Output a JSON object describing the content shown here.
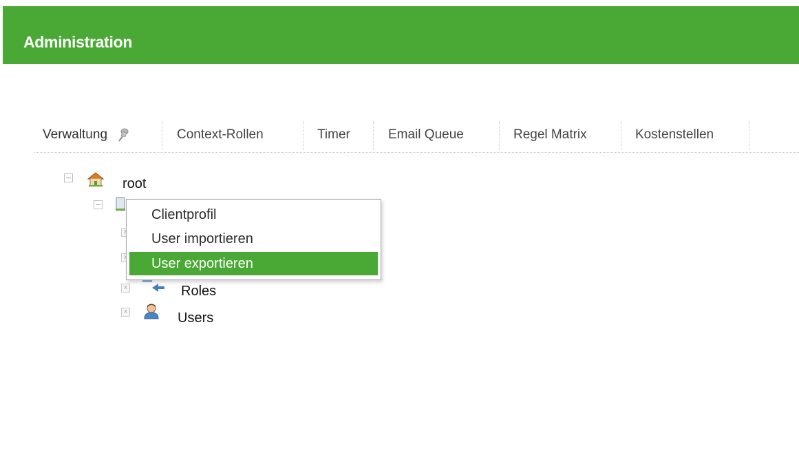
{
  "header": {
    "title": "Administration"
  },
  "tabs": [
    {
      "label": "Verwaltung",
      "active": true
    },
    {
      "label": "Context-Rollen"
    },
    {
      "label": "Timer"
    },
    {
      "label": "Email Queue"
    },
    {
      "label": "Regel Matrix"
    },
    {
      "label": "Kostenstellen"
    }
  ],
  "tree": {
    "root": {
      "label": "root",
      "icon": "home-icon"
    },
    "roles": {
      "label": "Roles",
      "icon": "roles-icon"
    },
    "users": {
      "label": "Users",
      "icon": "user-icon"
    }
  },
  "context_menu": {
    "items": [
      {
        "label": "Clientprofil"
      },
      {
        "label": "User importieren"
      },
      {
        "label": "User exportieren",
        "highlighted": true
      }
    ]
  },
  "colors": {
    "brand_green": "#4aa934"
  }
}
